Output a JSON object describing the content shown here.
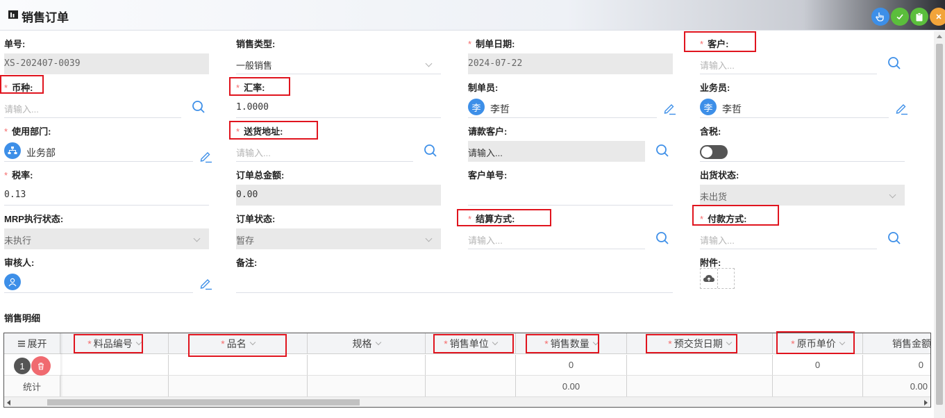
{
  "header": {
    "title": "销售订单",
    "title_icon": "report-icon"
  },
  "toolbar": {
    "buttons": [
      {
        "name": "hand-pointer-icon",
        "color": "#3d8fe8"
      },
      {
        "name": "check-icon",
        "color": "#5bbe3c"
      },
      {
        "name": "clipboard-icon",
        "color": "#5bbe3c"
      },
      {
        "name": "close-icon",
        "color": "#f2a43a"
      }
    ]
  },
  "form": {
    "order_no": {
      "label": "单号:",
      "value": "XS-202407-0039"
    },
    "sales_type": {
      "label": "销售类型:",
      "value": "一般销售"
    },
    "order_date": {
      "label": "制单日期:",
      "value": "2024-07-22"
    },
    "customer": {
      "label": "客户:",
      "placeholder": "请输入..."
    },
    "currency": {
      "label": "币种:",
      "placeholder": "请输入..."
    },
    "exchange_rate": {
      "label": "汇率:",
      "value": "1.0000"
    },
    "creator": {
      "label": "制单员:",
      "avatar": "李",
      "value": "李哲"
    },
    "salesperson": {
      "label": "业务员:",
      "avatar": "李",
      "value": "李哲"
    },
    "department": {
      "label": "使用部门:",
      "value": "业务部"
    },
    "delivery_address": {
      "label": "送货地址:",
      "placeholder": "请输入..."
    },
    "billing_customer": {
      "label": "请款客户:",
      "placeholder": "请输入..."
    },
    "tax_included": {
      "label": "含税:",
      "on": false
    },
    "tax_rate": {
      "label": "税率:",
      "value": "0.13"
    },
    "order_total": {
      "label": "订单总金额:",
      "value": "0.00"
    },
    "customer_order_no": {
      "label": "客户单号:",
      "value": ""
    },
    "shipping_status": {
      "label": "出货状态:",
      "value": "未出货"
    },
    "mrp_status": {
      "label": "MRP执行状态:",
      "value": "未执行"
    },
    "order_status": {
      "label": "订单状态:",
      "value": "暂存"
    },
    "settlement": {
      "label": "结算方式:",
      "placeholder": "请输入..."
    },
    "payment": {
      "label": "付款方式:",
      "placeholder": "请输入..."
    },
    "reviewer": {
      "label": "审核人:"
    },
    "remark": {
      "label": "备注:",
      "value": ""
    },
    "attachment": {
      "label": "附件:"
    }
  },
  "details": {
    "title": "销售明细",
    "expand_label": "展开",
    "columns": [
      "料品编号",
      "品名",
      "规格",
      "销售单位",
      "销售数量",
      "预交货日期",
      "原币单价",
      "销售金额"
    ],
    "required_columns": [
      true,
      true,
      false,
      true,
      true,
      true,
      true,
      false
    ],
    "rows": [
      {
        "index": "1",
        "qty": "0",
        "unit_price": "0",
        "amount": "0"
      }
    ],
    "summary": {
      "label": "统计",
      "qty": "0.00",
      "amount": "0.00"
    }
  },
  "theme": {
    "accent": "#3d8fe8",
    "required": "#f56c6c",
    "highlight_box": "#e0141e"
  }
}
